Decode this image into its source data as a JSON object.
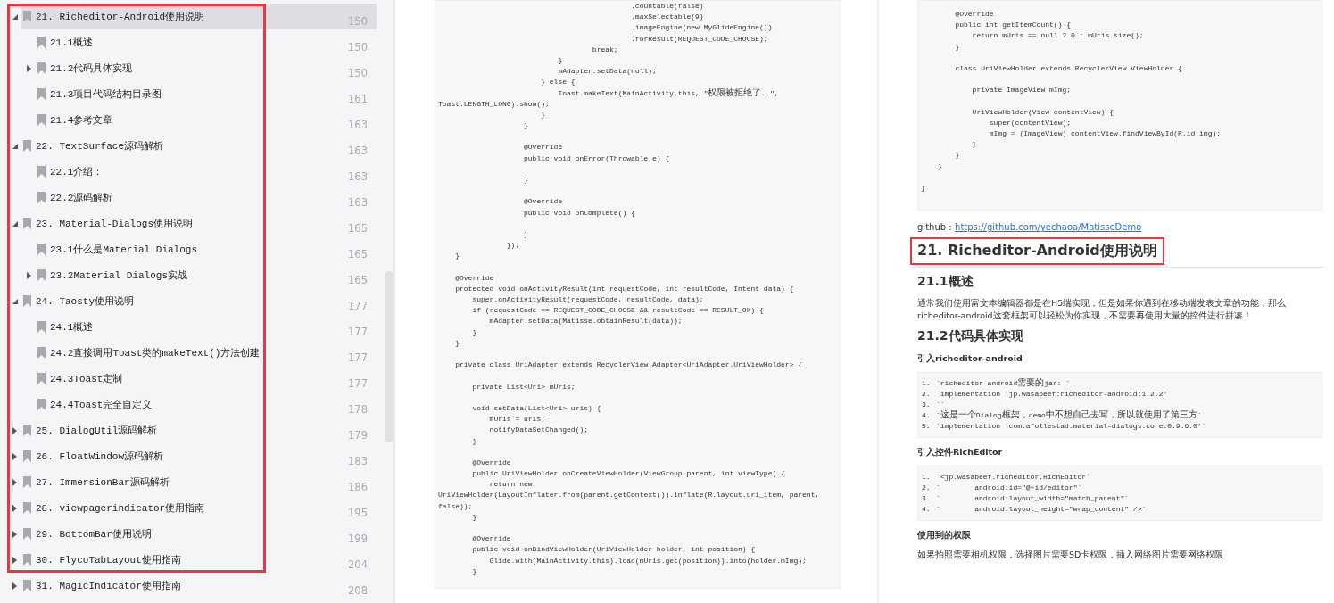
{
  "outline": [
    {
      "marked": true,
      "items": [
        {
          "label": "21. Richeditor-Android使用说明",
          "page": "150",
          "selected": true,
          "expanded": true,
          "children": [
            {
              "label": "21.1概述",
              "page": "150",
              "selected": false
            },
            {
              "label": "21.2代码具体实现",
              "page": "150",
              "selected": false,
              "expanded": false
            },
            {
              "label": "21.3项目代码结构目录图",
              "page": "161",
              "selected": false
            },
            {
              "label": "21.4参考文章",
              "page": "163",
              "selected": false
            }
          ]
        },
        {
          "label": "22. TextSurface源码解析",
          "page": "163",
          "selected": false,
          "expanded": true,
          "children": [
            {
              "label": "22.1介绍：",
              "page": "163",
              "selected": false
            },
            {
              "label": "22.2源码解析",
              "page": "163",
              "selected": false
            }
          ]
        },
        {
          "label": "23. Material-Dialogs使用说明",
          "page": "165",
          "selected": false,
          "expanded": true,
          "children": [
            {
              "label": "23.1什么是Material Dialogs",
              "page": "165",
              "selected": false
            },
            {
              "label": "23.2Material Dialogs实战",
              "page": "165",
              "selected": false,
              "expanded": false
            }
          ]
        },
        {
          "label": "24. Taosty使用说明",
          "page": "177",
          "selected": false,
          "expanded": true,
          "children": [
            {
              "label": "24.1概述",
              "page": "177",
              "selected": false
            },
            {
              "label": "24.2直接调用Toast类的makeText()方法创建",
              "page": "177",
              "selected": false
            },
            {
              "label": "24.3Toast定制",
              "page": "177",
              "selected": false
            },
            {
              "label": "24.4Toast完全自定义",
              "page": "178",
              "selected": false
            }
          ]
        },
        {
          "label": "25. DialogUtil源码解析",
          "page": "179",
          "selected": false,
          "expanded": false
        },
        {
          "label": "26. FloatWindow源码解析",
          "page": "183",
          "selected": false,
          "expanded": false
        },
        {
          "label": "27. ImmersionBar源码解析",
          "page": "186",
          "selected": false,
          "expanded": false
        },
        {
          "label": "28. viewpagerindicator使用指南",
          "page": "195",
          "selected": false,
          "expanded": false
        },
        {
          "label": "29. BottomBar使用说明",
          "page": "199",
          "selected": false,
          "expanded": false
        },
        {
          "label": "30. FlycoTabLayout使用指南",
          "page": "204",
          "selected": false,
          "expanded": false
        }
      ]
    },
    {
      "marked": false,
      "items": [
        {
          "label": "31. MagicIndicator使用指南",
          "page": "208",
          "selected": false,
          "expanded": false
        }
      ]
    }
  ],
  "middle_page": {
    "code": [
      [
        "                                             .countable(false)",
        "                                             .maxSelectable(9)",
        "                                             .imageEngine(new MyGlideEngine())",
        "                                             .forResult(REQUEST_CODE_CHOOSE);",
        "                                    break;",
        "                            }",
        "                            mAdapter.setData(null);",
        "                        } else {",
        "                            Toast.makeText(MainActivity.this, \"权限被拒绝了..\",",
        "Toast.LENGTH_LONG).show();",
        "                        }",
        "                    }"
      ],
      [
        "                    @Override",
        "                    public void onError(Throwable e) {"
      ],
      [
        "                    }"
      ],
      [
        "                    @Override",
        "                    public void onComplete() {"
      ],
      [
        "                    }",
        "                });",
        "    }"
      ],
      [
        "    @Override",
        "    protected void onActivityResult(int requestCode, int resultCode, Intent data) {",
        "        super.onActivityResult(requestCode, resultCode, data);",
        "        if (requestCode == REQUEST_CODE_CHOOSE && resultCode == RESULT_OK) {",
        "            mAdapter.setData(Matisse.obtainResult(data));",
        "        }",
        "    }"
      ],
      [
        "    private class UriAdapter extends RecyclerView.Adapter<UriAdapter.UriViewHolder> {"
      ],
      [
        "        private List<Uri> mUris;"
      ],
      [
        "        void setData(List<Uri> uris) {",
        "            mUris = uris;",
        "            notifyDataSetChanged();",
        "        }"
      ],
      [
        "        @Override",
        "        public UriViewHolder onCreateViewHolder(ViewGroup parent, int viewType) {",
        "            return new",
        "UriViewHolder(LayoutInflater.from(parent.getContext()).inflate(R.layout.uri_item, parent,",
        "false));",
        "        }"
      ],
      [
        "        @Override",
        "        public void onBindViewHolder(UriViewHolder holder, int position) {",
        "            Glide.with(MainActivity.this).load(mUris.get(position)).into(holder.mImg);",
        "        }"
      ]
    ]
  },
  "right_page": {
    "blocks": [
      {
        "kind": "code",
        "groups": [
          [
            "        @Override",
            "        public int getItemCount() {",
            "            return mUris == null ? 0 : mUris.size();",
            "        }"
          ],
          [
            "        class UriViewHolder extends RecyclerView.ViewHolder {"
          ],
          [
            "            private ImageView mImg;"
          ],
          [
            "            UriViewHolder(View contentView) {",
            "                super(contentView);",
            "                mImg = (ImageView) contentView.findViewById(R.id.img);",
            "            }",
            "        }",
            "    }"
          ],
          [
            "}"
          ]
        ]
      },
      {
        "kind": "link_line",
        "label": "github：",
        "link": "https://github.com/yechaoa/MatisseDemo"
      },
      {
        "kind": "h1",
        "text": "21. Richeditor-Android使用说明",
        "marked": true
      },
      {
        "kind": "h2",
        "text": "21.1概述"
      },
      {
        "kind": "p",
        "text": "通常我们使用富文本编辑器都是在H5端实现，但是如果你遇到在移动端发表文章的功能，那么richeditor-android这套框架可以轻松为你实现，不需要再使用大量的控件进行拼凑！"
      },
      {
        "kind": "h2",
        "text": "21.2代码具体实现"
      },
      {
        "kind": "h4",
        "text": "引入richeditor-android"
      },
      {
        "kind": "numbered_code",
        "lines": [
          {
            "number": "1.",
            "code": "`richeditor-android需要的jar: `"
          },
          {
            "number": "2.",
            "code": "`implementation 'jp.wasabeef:richeditor-android:1.2.2'`"
          },
          {
            "number": "3.",
            "code": "``"
          },
          {
            "number": "4.",
            "code": "`这是一个Dialog框架，demo中不想自己去写，所以就使用了第三方`"
          },
          {
            "number": "5.",
            "code": "`implementation 'com.afollestad.material-dialogs:core:0.9.6.0'`"
          }
        ]
      },
      {
        "kind": "h4",
        "text": "引入控件RichEditor"
      },
      {
        "kind": "numbered_code",
        "lines": [
          {
            "number": "1.",
            "code": "`<jp.wasabeef.richeditor.RichEditor`"
          },
          {
            "number": "2.",
            "code": "`        android:id=\"@+id/editor\"`"
          },
          {
            "number": "3.",
            "code": "`        android:layout_width=\"match_parent\"`"
          },
          {
            "number": "4.",
            "code": "`        android:layout_height=\"wrap_content\" />`"
          }
        ]
      },
      {
        "kind": "h4",
        "text": "使用到的权限"
      },
      {
        "kind": "p",
        "text": "如果拍照需要相机权限，选择图片需要SD卡权限，插入网络图片需要网络权限"
      }
    ]
  }
}
